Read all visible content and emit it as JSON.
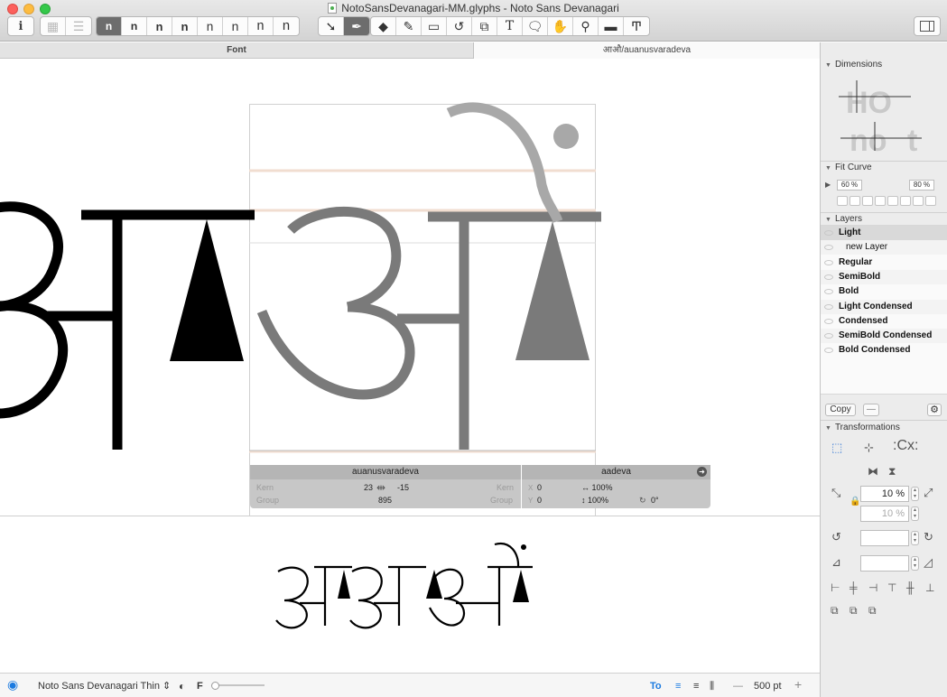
{
  "window": {
    "title": "NotoSansDevanagari-MM.glyphs - Noto Sans Devanagari",
    "traffic_lights": {
      "close": "#fc605c",
      "minimize": "#fdbc40",
      "zoom": "#34c84a"
    }
  },
  "toolbar": {
    "info_icon": "info-icon",
    "view_modes": [
      "grid-view-icon",
      "list-view-icon"
    ],
    "masters": [
      "n",
      "n",
      "n",
      "n",
      "n",
      "n",
      "n",
      "n"
    ],
    "active_master_index": 0,
    "tools": [
      "select-tool-icon",
      "draw-tool-icon",
      "eraser-tool-icon",
      "pencil-tool-icon",
      "rectangle-tool-icon",
      "rotate-tool-icon",
      "scale-tool-icon",
      "text-tool-icon",
      "annotation-tool-icon",
      "hand-tool-icon",
      "zoom-tool-icon",
      "measure-tool-icon",
      "text-size-tool-icon"
    ],
    "text_tool_glyph": "T",
    "sidebar_toggle_icon": "sidebar-toggle-icon"
  },
  "tabs": {
    "font": "Font",
    "glyph": "आऔ/auanusvaradeva"
  },
  "canvas": {
    "left_glyph": "अ",
    "edit_glyph_char": "औ",
    "accent": "#e9c9b3"
  },
  "kerning": {
    "left_glyph": "auanusvaradeva",
    "right_glyph": "aadeva",
    "kern_label": "Kern",
    "group_label": "Group",
    "left_kern": "23",
    "right_kern": "-15",
    "group_value": "895",
    "x_label": "X",
    "y_label": "Y",
    "x_value": "0",
    "y_value": "0",
    "width_scale": "↔ 100%",
    "height_scale": "↕ 100%",
    "rotation": "0°"
  },
  "preview": {
    "text": "अऻअऻऔं"
  },
  "bottombar": {
    "eye_icon": "eye-icon",
    "instance": "Noto Sans Devanagari Thin",
    "fill_icon": "half-circle-icon",
    "f_label": "F",
    "to_label": "To",
    "size_label": "500 pt",
    "minus": "—",
    "plus": "+"
  },
  "sidebar": {
    "dimensions": "Dimensions",
    "fit_curve": "Fit Curve",
    "fit_left": "60 %",
    "fit_right": "80 %",
    "layers_title": "Layers",
    "layers": [
      {
        "name": "Light",
        "sub": false
      },
      {
        "name": "new Layer",
        "sub": true
      },
      {
        "name": "Regular",
        "sub": false
      },
      {
        "name": "SemiBold",
        "sub": false
      },
      {
        "name": "Bold",
        "sub": false
      },
      {
        "name": "Light Condensed",
        "sub": false
      },
      {
        "name": "Condensed",
        "sub": false
      },
      {
        "name": "SemiBold Condensed",
        "sub": false
      },
      {
        "name": "Bold Condensed",
        "sub": false
      }
    ],
    "copy_label": "Copy",
    "minus_label": "—",
    "gear_icon": "gear-icon",
    "transformations": "Transformations",
    "scale_1": "10 %",
    "scale_2": "10 %",
    "cx_label": "Cx"
  }
}
